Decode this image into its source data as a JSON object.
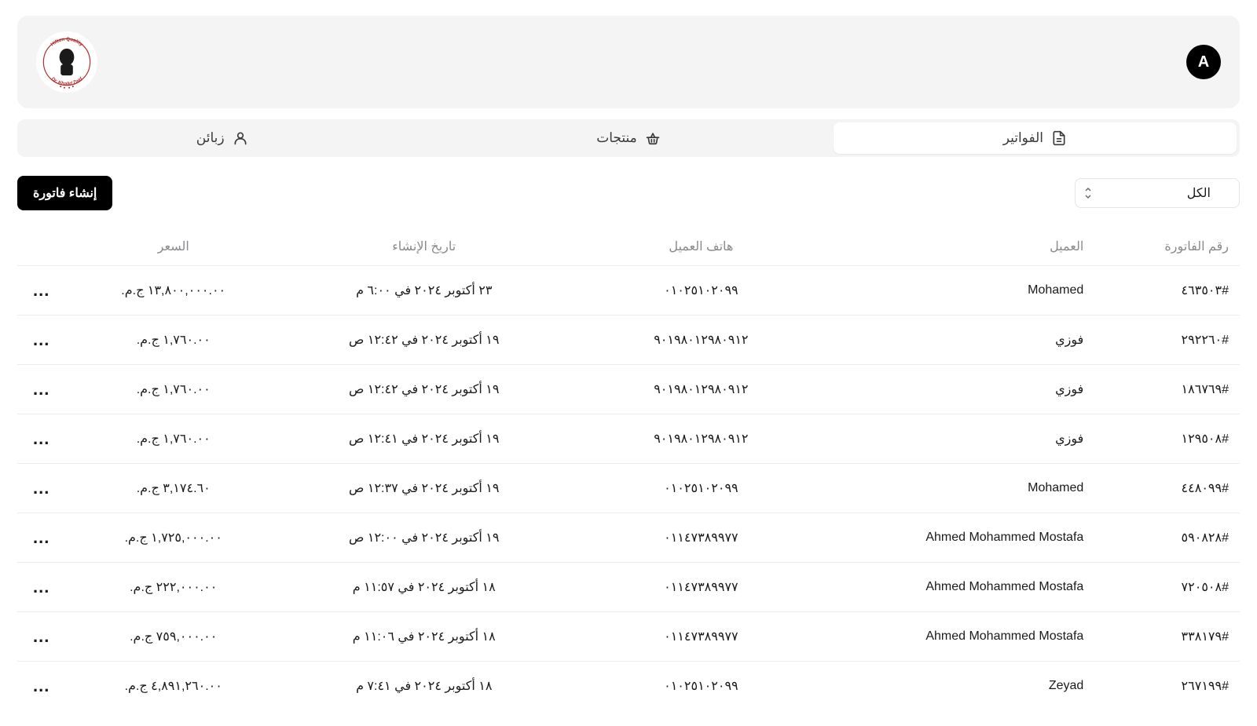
{
  "header": {
    "avatar_letter": "A",
    "logo_top": "Hilton Quality",
    "logo_bottom": "Dr. Khalid Zaid"
  },
  "tabs": {
    "invoices": "الفواتير",
    "products": "منتجات",
    "customers": "زبائن"
  },
  "toolbar": {
    "filter_selected": "الكل",
    "create_label": "إنشاء فاتورة"
  },
  "table": {
    "headers": {
      "invoice": "رقم الفاتورة",
      "customer": "العميل",
      "phone": "هاتف العميل",
      "created": "تاريخ الإنشاء",
      "price": "السعر"
    },
    "rows": [
      {
        "invoice": "#٤٦٣٥٠٣",
        "customer": "Mohamed",
        "phone": "٠١٠٢٥١٠٢٠٩٩",
        "created": "٢٣ أكتوبر ٢٠٢٤ في ٦:٠٠ م",
        "price": "١٣,٨٠٠,٠٠٠.٠٠ ج.م.‏"
      },
      {
        "invoice": "#٢٩٢٢٦٠",
        "customer": "فوزي",
        "phone": "٩٠١٩٨٠١٢٩٨٠٩١٢",
        "created": "١٩ أكتوبر ٢٠٢٤ في ١٢:٤٢ ص",
        "price": "١,٧٦٠.٠٠ ج.م.‏"
      },
      {
        "invoice": "#١٨٦٧٦٩",
        "customer": "فوزي",
        "phone": "٩٠١٩٨٠١٢٩٨٠٩١٢",
        "created": "١٩ أكتوبر ٢٠٢٤ في ١٢:٤٢ ص",
        "price": "١,٧٦٠.٠٠ ج.م.‏"
      },
      {
        "invoice": "#١٢٩٥٠٨",
        "customer": "فوزي",
        "phone": "٩٠١٩٨٠١٢٩٨٠٩١٢",
        "created": "١٩ أكتوبر ٢٠٢٤ في ١٢:٤١ ص",
        "price": "١,٧٦٠.٠٠ ج.م.‏"
      },
      {
        "invoice": "#٤٤٨٠٩٩",
        "customer": "Mohamed",
        "phone": "٠١٠٢٥١٠٢٠٩٩",
        "created": "١٩ أكتوبر ٢٠٢٤ في ١٢:٣٧ ص",
        "price": "٣,١٧٤.٦٠ ج.م.‏"
      },
      {
        "invoice": "#٥٩٠٨٢٨",
        "customer": "Ahmed Mohammed Mostafa",
        "phone": "٠١١٤٧٣٨٩٩٧٧",
        "created": "١٩ أكتوبر ٢٠٢٤ في ١٢:٠٠ ص",
        "price": "١,٧٢٥,٠٠٠.٠٠ ج.م.‏"
      },
      {
        "invoice": "#٧٢٠٥٠٨",
        "customer": "Ahmed Mohammed Mostafa",
        "phone": "٠١١٤٧٣٨٩٩٧٧",
        "created": "١٨ أكتوبر ٢٠٢٤ في ١١:٥٧ م",
        "price": "٢٢٢,٠٠٠.٠٠ ج.م.‏"
      },
      {
        "invoice": "#٣٣٨١٧٩",
        "customer": "Ahmed Mohammed Mostafa",
        "phone": "٠١١٤٧٣٨٩٩٧٧",
        "created": "١٨ أكتوبر ٢٠٢٤ في ١١:٠٦ م",
        "price": "٧٥٩,٠٠٠.٠٠ ج.م.‏"
      },
      {
        "invoice": "#٢٦٧١٩٩",
        "customer": "Zeyad",
        "phone": "٠١٠٢٥١٠٢٠٩٩",
        "created": "١٨ أكتوبر ٢٠٢٤ في ٧:٤١ م",
        "price": "٤,٨٩١,٢٦٠.٠٠ ج.م.‏"
      }
    ]
  },
  "actions": {
    "more": "..."
  }
}
